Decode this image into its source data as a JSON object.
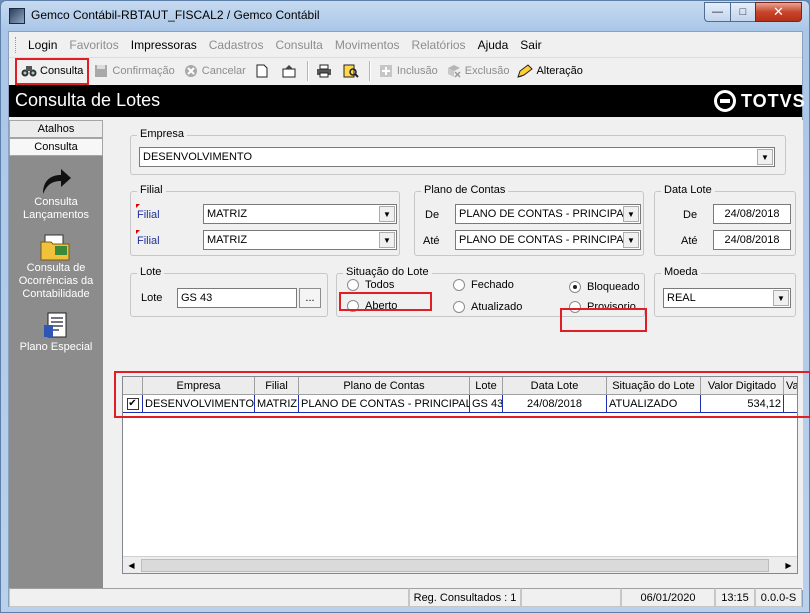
{
  "window": {
    "title": "Gemco Contábil-RBTAUT_FISCAL2 / Gemco Contábil",
    "close_glyph": "✕",
    "max_glyph": "□",
    "min_glyph": "—"
  },
  "menu": [
    {
      "label": "Login",
      "enabled": true
    },
    {
      "label": "Favoritos",
      "enabled": false
    },
    {
      "label": "Impressoras",
      "enabled": true
    },
    {
      "label": "Cadastros",
      "enabled": false
    },
    {
      "label": "Consulta",
      "enabled": false
    },
    {
      "label": "Movimentos",
      "enabled": false
    },
    {
      "label": "Relatórios",
      "enabled": false
    },
    {
      "label": "Ajuda",
      "enabled": true
    },
    {
      "label": "Sair",
      "enabled": true
    }
  ],
  "toolbar": {
    "consulta": "Consulta",
    "confirmacao": "Confirmação",
    "cancelar": "Cancelar",
    "inclusao": "Inclusão",
    "exclusao": "Exclusão",
    "alteracao": "Alteração"
  },
  "header": {
    "title": "Consulta de Lotes",
    "brand": "TOTVS"
  },
  "sidebar": {
    "tabs": [
      "Atalhos",
      "Consulta"
    ],
    "items": [
      {
        "label": "Consulta Lançamentos",
        "icon": "arrow-icon"
      },
      {
        "label": "Consulta de Ocorrências da Contabilidade",
        "icon": "folder-icon"
      },
      {
        "label": "Plano Especial",
        "icon": "document-icon"
      }
    ]
  },
  "form": {
    "empresa": {
      "label": "Empresa",
      "value": "DESENVOLVIMENTO"
    },
    "filial": {
      "label": "Filial",
      "field_label": "Filial",
      "de": "MATRIZ",
      "ate": "MATRIZ"
    },
    "plano": {
      "label": "Plano de Contas",
      "de_label": "De",
      "ate_label": "Até",
      "de": "PLANO DE CONTAS - PRINCIPAL",
      "ate": "PLANO DE CONTAS - PRINCIPAL"
    },
    "data_lote": {
      "label": "Data Lote",
      "de_label": "De",
      "ate_label": "Até",
      "de": "24/08/2018",
      "ate": "24/08/2018"
    },
    "lote": {
      "label": "Lote",
      "field_label": "Lote",
      "value": "GS 43",
      "button": "..."
    },
    "situacao": {
      "label": "Situação do Lote",
      "options": [
        "Todos",
        "Aberto",
        "Fechado",
        "Atualizado",
        "Bloqueado",
        "Provisorio"
      ],
      "selected": "Bloqueado"
    },
    "moeda": {
      "label": "Moeda",
      "value": "REAL"
    }
  },
  "grid": {
    "columns": [
      "",
      "Empresa",
      "Filial",
      "Plano de Contas",
      "Lote",
      "Data Lote",
      "Situação do Lote",
      "Valor Digitado",
      "Valo"
    ],
    "rows": [
      {
        "checked": true,
        "check_glyph": "✔",
        "cells": [
          "DESENVOLVIMENTO",
          "MATRIZ",
          "PLANO DE CONTAS - PRINCIPAL",
          "GS 43",
          "24/08/2018",
          "ATUALIZADO",
          "534,12",
          ""
        ]
      }
    ]
  },
  "status": {
    "reg": "Reg. Consultados : 1",
    "date": "06/01/2020",
    "time": "13:15",
    "version": "0.0.0-S"
  },
  "colors": {
    "highlight": "#e01e26",
    "header_bg": "#000000",
    "sidebar_bg": "#8c8c8c"
  }
}
